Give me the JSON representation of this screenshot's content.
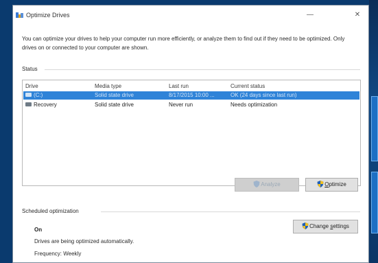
{
  "window": {
    "title": "Optimize Drives",
    "minimize": "—",
    "close": "✕"
  },
  "intro_text": "You can optimize your drives to help your computer run more efficiently, or analyze them to find out if they need to be optimized. Only drives on or connected to your computer are shown.",
  "status_label": "Status",
  "table": {
    "headers": [
      "Drive",
      "Media type",
      "Last run",
      "Current status"
    ],
    "rows": [
      {
        "drive": "(C:)",
        "media": "Solid state drive",
        "last_run": "8/17/2015 10:00 ...",
        "status": "OK (24 days since last run)",
        "selected": true
      },
      {
        "drive": "Recovery",
        "media": "Solid state drive",
        "last_run": "Never run",
        "status": "Needs optimization",
        "selected": false
      }
    ]
  },
  "buttons": {
    "analyze": "Analyze",
    "optimize_prefix": "",
    "optimize_u": "O",
    "optimize_rest": "ptimize",
    "change_prefix": "Change ",
    "change_u": "s",
    "change_rest": "ettings"
  },
  "scheduled": {
    "label": "Scheduled optimization",
    "state": "On",
    "description": "Drives are being optimized automatically.",
    "frequency": "Frequency: Weekly"
  },
  "colors": {
    "selection": "#2f83d8",
    "desktop": "#0a3a6e",
    "shield_blue": "#1f5fb8",
    "shield_yellow": "#f0c020"
  }
}
